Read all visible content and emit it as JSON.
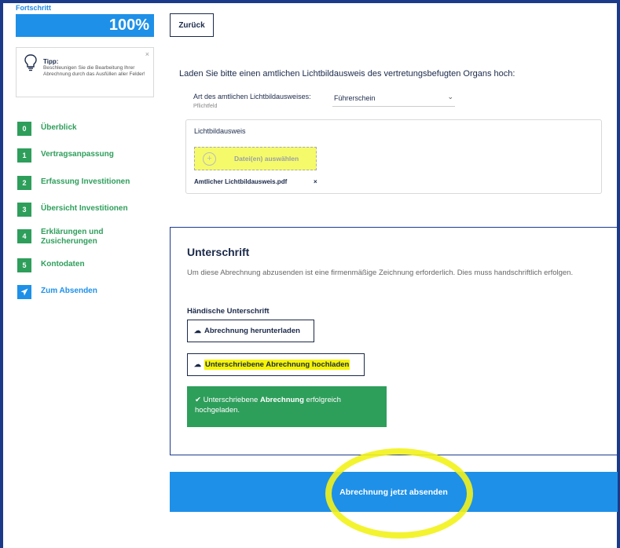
{
  "progress": {
    "label": "Fortschritt",
    "value_text": "100%",
    "fraction": 1.0
  },
  "tip": {
    "title": "Tipp:",
    "text": "Beschleunigen Sie die Bearbeitung Ihrer Abrechnung durch das Ausfüllen aller Felder!",
    "close": "×"
  },
  "steps": [
    {
      "num": "0",
      "label": "Überblick"
    },
    {
      "num": "1",
      "label": "Vertragsanpassung"
    },
    {
      "num": "2",
      "label": "Erfassung Investitionen"
    },
    {
      "num": "3",
      "label": "Übersicht Investitionen"
    },
    {
      "num": "4",
      "label": "Erklärungen und Zusicherungen"
    },
    {
      "num": "5",
      "label": "Kontodaten"
    },
    {
      "num": "",
      "label": "Zum Absenden",
      "icon": "send-icon"
    }
  ],
  "back_button": "Zurück",
  "upload": {
    "heading": "Laden Sie bitte einen amtlichen Lichtbildausweis des vertretungsbefugten Organs hoch:",
    "doc_type_label": "Art des amtlichen Lichtbildausweises:",
    "required": "Pflichtfeld",
    "doc_type_value": "Führerschein",
    "box_title": "Lichtbildausweis",
    "dropzone_label": "Datei(en) auswählen",
    "file_name": "Amtlicher Lichtbildausweis.pdf",
    "file_remove": "×"
  },
  "signature": {
    "title": "Unterschrift",
    "text": "Um diese Abrechnung abzusenden ist eine firmenmäßige Zeichnung erforderlich. Dies muss handschriftlich erfolgen.",
    "subtitle": "Händische Unterschrift",
    "download_button": "Abrechnung herunterladen",
    "upload_button": "Unterschriebene Abrechnung hochladen",
    "success_pre": "Unterschriebene ",
    "success_bold": "Abrechnung",
    "success_post": " erfolgreich hochgeladen."
  },
  "submit_button": "Abrechnung jetzt absenden",
  "colors": {
    "primary": "#1e90e8",
    "success": "#2e9e5b",
    "navy": "#1b2a4a",
    "highlight": "#f7f400"
  }
}
